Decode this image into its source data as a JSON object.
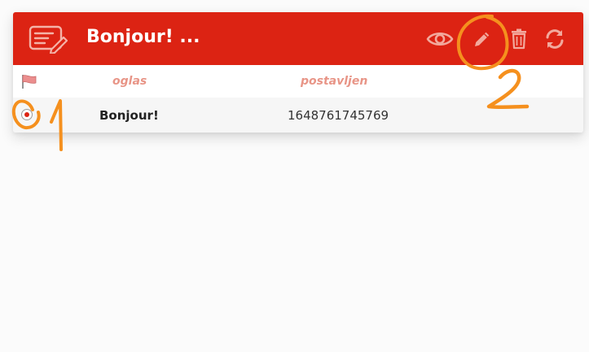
{
  "header": {
    "title": "Bonjour! ...",
    "logo_icon": "edit-document-icon",
    "background": "#dc2313",
    "toolbar": [
      {
        "icon": "eye-icon",
        "name": "view"
      },
      {
        "icon": "pencil-icon",
        "name": "edit"
      },
      {
        "icon": "trash-icon",
        "name": "delete"
      },
      {
        "icon": "refresh-icon",
        "name": "refresh"
      }
    ]
  },
  "table": {
    "flag_icon": "flag-icon",
    "columns": [
      "oglas",
      "postavljen"
    ],
    "rows": [
      {
        "selected": true,
        "oglas": "Bonjour!",
        "postavljen": "1648761745769"
      }
    ]
  },
  "annotations": {
    "color": "#f5901e",
    "labels": [
      "1",
      "2"
    ]
  }
}
